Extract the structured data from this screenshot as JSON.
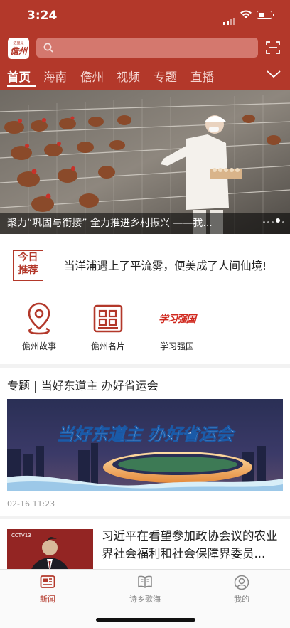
{
  "status_bar": {
    "time": "3:24"
  },
  "header": {
    "logo": {
      "top_text": "这里是",
      "main_text": "儋州"
    },
    "search": {
      "placeholder": ""
    },
    "tabs": [
      {
        "label": "首页",
        "active": true
      },
      {
        "label": "海南"
      },
      {
        "label": "儋州"
      },
      {
        "label": "视频"
      },
      {
        "label": "专题"
      },
      {
        "label": "直播"
      }
    ]
  },
  "banner": {
    "caption": "聚力“巩固与衔接” 全力推进乡村振兴 ——我...",
    "slide_count": 5,
    "active_slide": 4
  },
  "today": {
    "badge": [
      "今日",
      "推荐"
    ],
    "headline": "当洋浦遇上了平流雾，便美成了人间仙境!"
  },
  "quick_links": [
    {
      "label": "儋州故事",
      "icon": "location-pin-icon"
    },
    {
      "label": "儋州名片",
      "icon": "card-grid-icon"
    },
    {
      "label": "学习强国",
      "icon": "xuexi-logo",
      "logo_text": "学习强国"
    }
  ],
  "topic": {
    "section_title": "专题 | 当好东道主 办好省运会",
    "image_text": "当好东道主 办好省运会",
    "date": "02-16 11:23"
  },
  "news": {
    "title": "习近平在看望参加政协会议的农业界社会福利和社会保障界委员...",
    "thumb_badge": "CCTV13"
  },
  "tabbar": [
    {
      "label": "新闻",
      "icon": "news-icon",
      "active": true
    },
    {
      "label": "诗乡歌海",
      "icon": "book-icon"
    },
    {
      "label": "我的",
      "icon": "user-icon"
    }
  ],
  "colors": {
    "brand": "#b3382a",
    "text": "#222222",
    "muted": "#999999"
  }
}
